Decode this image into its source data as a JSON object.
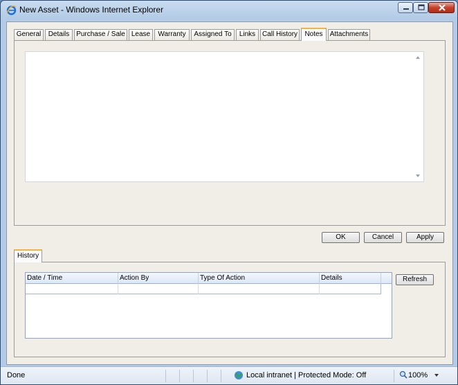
{
  "window": {
    "title": "New Asset - Windows Internet Explorer"
  },
  "tabs": [
    {
      "label": "General"
    },
    {
      "label": "Details"
    },
    {
      "label": "Purchase / Sale"
    },
    {
      "label": "Lease"
    },
    {
      "label": "Warranty"
    },
    {
      "label": "Assigned To"
    },
    {
      "label": "Links"
    },
    {
      "label": "Call History"
    },
    {
      "label": "Notes",
      "active": true
    },
    {
      "label": "Attachments"
    }
  ],
  "notes": {
    "value": ""
  },
  "buttons": {
    "ok": "OK",
    "cancel": "Cancel",
    "apply": "Apply",
    "refresh": "Refresh"
  },
  "history": {
    "tab_label": "History",
    "columns": [
      "Date / Time",
      "Action By",
      "Type Of Action",
      "Details"
    ],
    "rows": []
  },
  "statusbar": {
    "status": "Done",
    "zone": "Local intranet | Protected Mode: Off",
    "zoom": "100%"
  },
  "colors": {
    "active_tab_accent": "#f4b33d",
    "close_button": "#c4412a",
    "title_gradient": "#c9dcf0"
  },
  "icons": [
    "ie-logo-icon",
    "minimize-icon",
    "maximize-icon",
    "close-icon",
    "globe-icon",
    "zoom-icon",
    "chevron-down-icon"
  ]
}
